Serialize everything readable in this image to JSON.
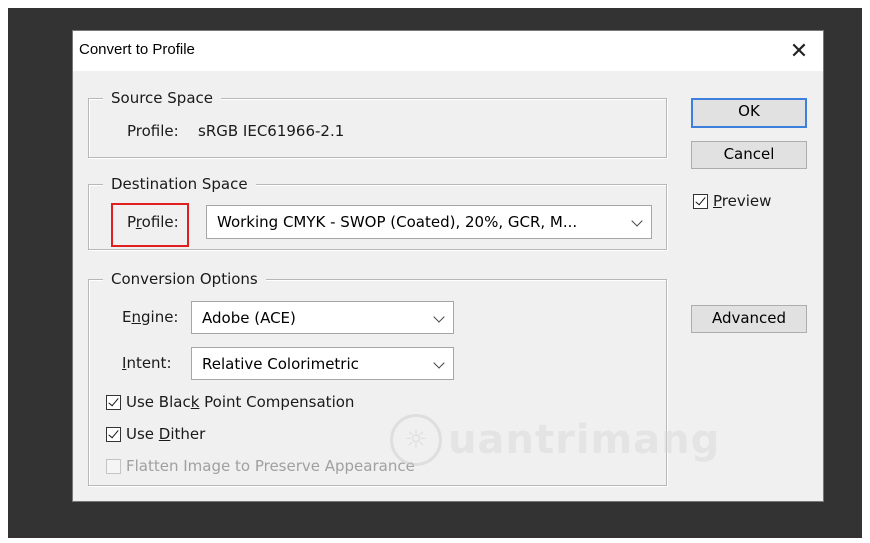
{
  "dialog": {
    "title": "Convert to Profile",
    "close_icon": "close-icon"
  },
  "source_space": {
    "legend": "Source Space",
    "profile_label": "Profile:",
    "profile_value": "sRGB IEC61966-2.1"
  },
  "destination_space": {
    "legend": "Destination Space",
    "profile_label_pre": "P",
    "profile_label_mnemonic": "r",
    "profile_label_post": "ofile:",
    "profile_selected": "Working CMYK - SWOP (Coated), 20%, GCR, M..."
  },
  "conversion_options": {
    "legend": "Conversion Options",
    "engine_label_pre": "E",
    "engine_label_mnemonic": "n",
    "engine_label_post": "gine:",
    "engine_selected": "Adobe (ACE)",
    "intent_label_mnemonic": "I",
    "intent_label_post": "ntent:",
    "intent_selected": "Relative Colorimetric",
    "black_point": {
      "label_pre": "Use Blac",
      "label_mnemonic": "k",
      "label_post": " Point Compensation",
      "checked": true
    },
    "dither": {
      "label_pre": "Use ",
      "label_mnemonic": "D",
      "label_post": "ither",
      "checked": true
    },
    "flatten": {
      "label": "Flatten Image to Preserve Appearance",
      "checked": false,
      "enabled": false
    }
  },
  "buttons": {
    "ok": "OK",
    "cancel": "Cancel",
    "advanced": "Advanced"
  },
  "preview": {
    "label_mnemonic": "P",
    "label_post": "review",
    "checked": true
  },
  "watermark": {
    "text": "uantrimang",
    "logo_icon": "quantrimang-logo-icon"
  },
  "colors": {
    "backdrop": "#333334",
    "dialog_bg": "#f0f0f0",
    "highlight": "#e02020",
    "default_button_border": "#3c7fdc"
  }
}
